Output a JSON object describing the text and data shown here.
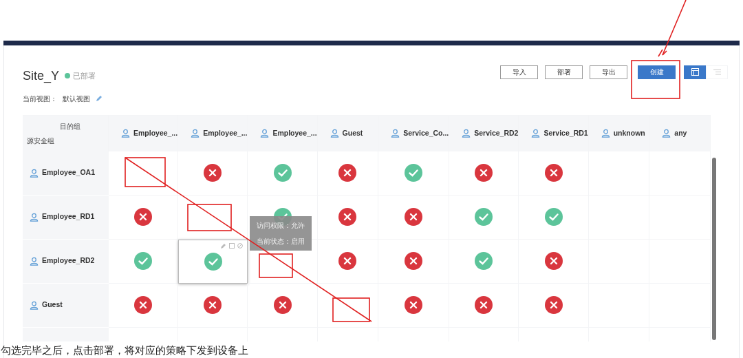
{
  "header": {
    "title": "Site_Y",
    "status": {
      "label": "已部署",
      "color": "#5cc49a"
    },
    "view_label": "当前视图：",
    "view_name": "默认视图"
  },
  "toolbar": {
    "buttons": [
      {
        "label": "导入",
        "kind": "outline"
      },
      {
        "label": "部署",
        "kind": "outline"
      },
      {
        "label": "导出",
        "kind": "outline"
      },
      {
        "label": "创建",
        "kind": "primary"
      }
    ],
    "views": [
      {
        "kind": "grid",
        "selected": true
      },
      {
        "kind": "list",
        "selected": false
      }
    ]
  },
  "matrix": {
    "corner_top": "目的组",
    "corner_bottom": "源安全组",
    "columns": [
      "Employee_...",
      "Employee_...",
      "Employee_...",
      "Guest",
      "Service_Co...",
      "Service_RD2",
      "Service_RD1",
      "unknown",
      "any"
    ],
    "rows": [
      {
        "name": "Employee_OA1",
        "cells": [
          {
            "kind": "empty",
            "selected": false
          },
          {
            "kind": "deny",
            "selected": false
          },
          {
            "kind": "allow",
            "selected": false
          },
          {
            "kind": "deny",
            "selected": false
          },
          {
            "kind": "allow",
            "selected": false
          },
          {
            "kind": "deny",
            "selected": false
          },
          {
            "kind": "deny",
            "selected": false
          },
          {
            "kind": "empty",
            "selected": false
          },
          {
            "kind": "empty",
            "selected": false
          }
        ]
      },
      {
        "name": "Employee_RD1",
        "cells": [
          {
            "kind": "deny",
            "selected": false
          },
          {
            "kind": "empty",
            "selected": false
          },
          {
            "kind": "allow",
            "selected": false
          },
          {
            "kind": "deny",
            "selected": false
          },
          {
            "kind": "deny",
            "selected": false
          },
          {
            "kind": "allow",
            "selected": false
          },
          {
            "kind": "allow",
            "selected": false
          },
          {
            "kind": "empty",
            "selected": false
          },
          {
            "kind": "empty",
            "selected": false
          }
        ]
      },
      {
        "name": "Employee_RD2",
        "cells": [
          {
            "kind": "allow",
            "selected": false
          },
          {
            "kind": "allow",
            "selected": true
          },
          {
            "kind": "empty",
            "selected": false
          },
          {
            "kind": "deny",
            "selected": false
          },
          {
            "kind": "deny",
            "selected": false
          },
          {
            "kind": "allow",
            "selected": false
          },
          {
            "kind": "deny",
            "selected": false
          },
          {
            "kind": "empty",
            "selected": false
          },
          {
            "kind": "empty",
            "selected": false
          }
        ]
      },
      {
        "name": "Guest",
        "cells": [
          {
            "kind": "deny",
            "selected": false
          },
          {
            "kind": "deny",
            "selected": false
          },
          {
            "kind": "deny",
            "selected": false
          },
          {
            "kind": "empty",
            "selected": false
          },
          {
            "kind": "deny",
            "selected": false
          },
          {
            "kind": "deny",
            "selected": false
          },
          {
            "kind": "deny",
            "selected": false
          },
          {
            "kind": "empty",
            "selected": false
          },
          {
            "kind": "empty",
            "selected": false
          }
        ]
      }
    ],
    "tooltip": {
      "lines": [
        "访问权限：允许",
        "当前状态：启用"
      ]
    }
  },
  "caption": "勾选完毕之后，点击部署，将对应的策略下发到设备上"
}
